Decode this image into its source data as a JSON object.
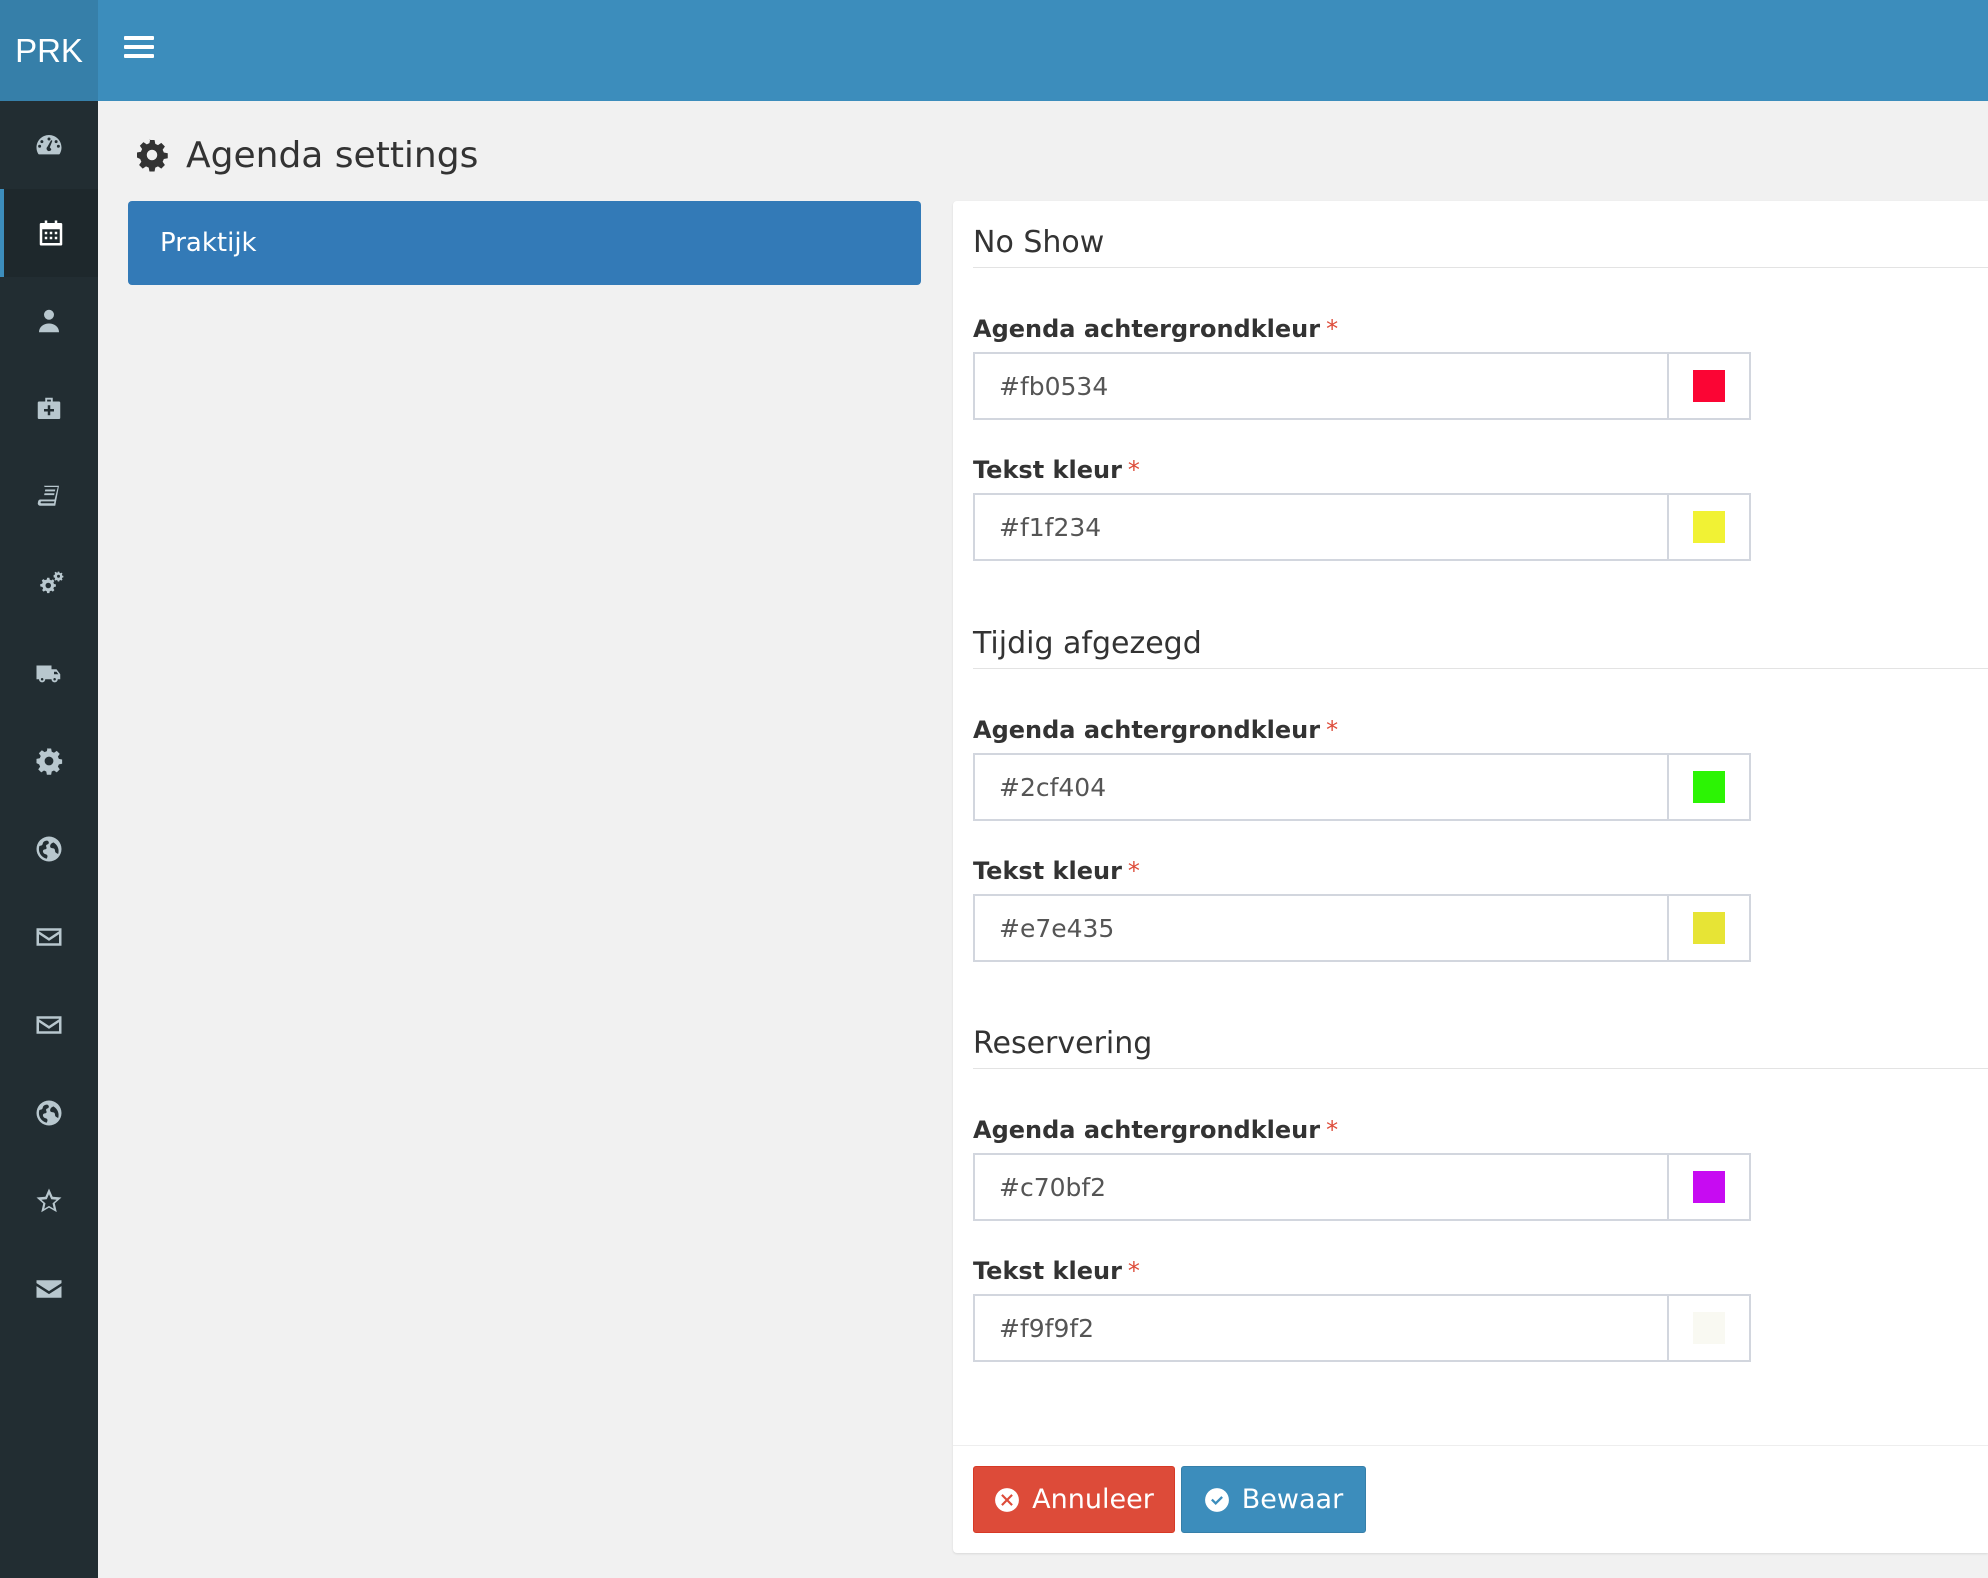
{
  "app": {
    "logo": "PRK"
  },
  "page": {
    "title": "Agenda settings"
  },
  "left_nav": {
    "items": [
      {
        "label": "Praktijk"
      }
    ]
  },
  "sidebar": {
    "icons": [
      "dashboard-icon",
      "calendar-icon",
      "user-icon",
      "medkit-icon",
      "book-icon",
      "cogs-icon",
      "truck-icon",
      "cog-icon",
      "globe-icon",
      "envelope-outline-icon",
      "envelope-outline-icon",
      "globe-icon",
      "star-icon",
      "envelope-icon"
    ],
    "active_index": 1
  },
  "sections": [
    {
      "title": "No Show",
      "fields": [
        {
          "label": "Agenda achtergrondkleur",
          "required": "*",
          "value": "#fb0534",
          "color": "#fb0534"
        },
        {
          "label": "Tekst kleur",
          "required": "*",
          "value": "#f1f234",
          "color": "#f1f234"
        }
      ]
    },
    {
      "title": "Tijdig afgezegd",
      "fields": [
        {
          "label": "Agenda achtergrondkleur",
          "required": "*",
          "value": "#2cf404",
          "color": "#2cf404"
        },
        {
          "label": "Tekst kleur",
          "required": "*",
          "value": "#e7e435",
          "color": "#e7e435"
        }
      ]
    },
    {
      "title": "Reservering",
      "fields": [
        {
          "label": "Agenda achtergrondkleur",
          "required": "*",
          "value": "#c70bf2",
          "color": "#c70bf2"
        },
        {
          "label": "Tekst kleur",
          "required": "*",
          "value": "#f9f9f2",
          "color": "#f9f9f2"
        }
      ]
    }
  ],
  "buttons": {
    "cancel": "Annuleer",
    "save": "Bewaar"
  },
  "colors": {
    "topbar": "#3c8dbc",
    "sidebar": "#222d32",
    "primary": "#337ab7",
    "danger": "#dd4b39"
  }
}
